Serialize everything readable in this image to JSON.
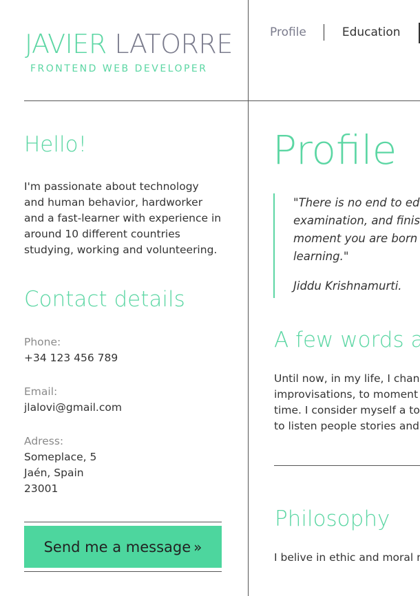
{
  "header": {
    "first_name": "JAVIER",
    "last_name": "LATORRE",
    "role": "FRONTEND WEB DEVELOPER"
  },
  "nav": {
    "items": [
      {
        "label": "Profile",
        "active": true
      },
      {
        "label": "Education",
        "active": false
      }
    ]
  },
  "sidebar": {
    "hello_heading": "Hello!",
    "intro_lines": [
      "I'm passionate about technology",
      "and human behavior, hardworker",
      "and a fast-learner with experience in",
      "around 10 different countries",
      "studying, working and volunteering."
    ],
    "contact_heading": "Contact details",
    "phone_label": "Phone:",
    "phone_value": "+34 123 456 789",
    "email_label": "Email:",
    "email_value": "jlalovi@gmail.com",
    "address_label": "Adress:",
    "address_lines": [
      "Someplace, 5",
      "Jaén, Spain",
      "23001"
    ],
    "send_button_label": "Send me a message",
    "send_button_arrow": "»"
  },
  "main": {
    "profile_heading": "Profile",
    "quote_lines": [
      "\"There is no end to edu",
      "examination, and finis",
      "moment you are born",
      "learning.\""
    ],
    "quote_author": "Jiddu Krishnamurti.",
    "few_words_heading": "A few words al",
    "few_words_lines": [
      "Until now, in my life, I chang",
      "improvisations, to moment",
      "time. I consider myself a tol",
      "to listen people stories and"
    ],
    "philosophy_heading": "Philosophy",
    "philosophy_line": "I belive in ethic and moral n"
  },
  "colors": {
    "accent": "#5bd6a3",
    "button": "#4dd69e",
    "muted": "#7a7b8c",
    "text": "#333333"
  }
}
